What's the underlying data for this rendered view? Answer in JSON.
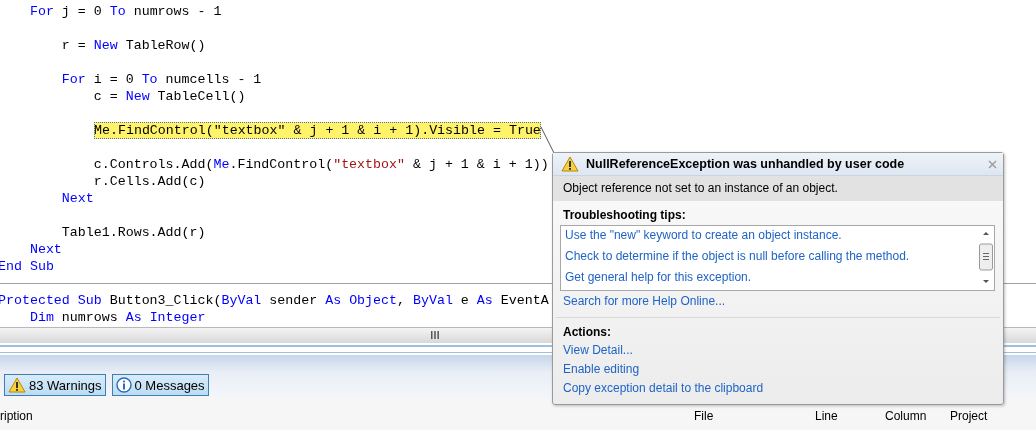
{
  "editor": {
    "lines": [
      {
        "kind": "code",
        "highlighted": false,
        "tokens": [
          {
            "text": "    For",
            "kind": "keyword"
          },
          {
            "text": " j = 0 ",
            "kind": "plain"
          },
          {
            "text": "To",
            "kind": "keyword"
          },
          {
            "text": " numrows - 1",
            "kind": "plain"
          }
        ]
      },
      {
        "kind": "blank"
      },
      {
        "kind": "code",
        "highlighted": false,
        "tokens": [
          {
            "text": "        r = ",
            "kind": "plain"
          },
          {
            "text": "New",
            "kind": "keyword"
          },
          {
            "text": " TableRow()",
            "kind": "plain"
          }
        ]
      },
      {
        "kind": "blank"
      },
      {
        "kind": "code",
        "highlighted": false,
        "tokens": [
          {
            "text": "        For",
            "kind": "keyword"
          },
          {
            "text": " i = 0 ",
            "kind": "plain"
          },
          {
            "text": "To",
            "kind": "keyword"
          },
          {
            "text": " numcells - 1",
            "kind": "plain"
          }
        ]
      },
      {
        "kind": "code",
        "highlighted": false,
        "tokens": [
          {
            "text": "            c = ",
            "kind": "plain"
          },
          {
            "text": "New",
            "kind": "keyword"
          },
          {
            "text": " TableCell()",
            "kind": "plain"
          }
        ]
      },
      {
        "kind": "blank"
      },
      {
        "kind": "code",
        "highlighted": true,
        "tokens": [
          {
            "text": "Me.FindControl(\"textbox\" & j + 1 & i + 1).Visible = True",
            "kind": "plain"
          }
        ]
      },
      {
        "kind": "blank"
      },
      {
        "kind": "code",
        "highlighted": false,
        "tokens": [
          {
            "text": "            c.Controls.Add(",
            "kind": "plain"
          },
          {
            "text": "Me",
            "kind": "keyword"
          },
          {
            "text": ".FindControl(",
            "kind": "plain"
          },
          {
            "text": "\"textbox\"",
            "kind": "string"
          },
          {
            "text": " & j + 1 & i + 1))",
            "kind": "plain"
          }
        ]
      },
      {
        "kind": "code",
        "highlighted": false,
        "tokens": [
          {
            "text": "            r.Cells.Add(c)",
            "kind": "plain"
          }
        ]
      },
      {
        "kind": "code",
        "highlighted": false,
        "tokens": [
          {
            "text": "        Next",
            "kind": "keyword"
          }
        ]
      },
      {
        "kind": "blank"
      },
      {
        "kind": "code",
        "highlighted": false,
        "tokens": [
          {
            "text": "        Table1.Rows.Add(r)",
            "kind": "plain"
          }
        ]
      },
      {
        "kind": "code",
        "highlighted": false,
        "tokens": [
          {
            "text": "    Next",
            "kind": "keyword"
          }
        ]
      },
      {
        "kind": "code",
        "highlighted": false,
        "tokens": [
          {
            "text": "End Sub",
            "kind": "keyword"
          }
        ]
      },
      {
        "kind": "divider"
      },
      {
        "kind": "code",
        "highlighted": false,
        "tokens": [
          {
            "text": "Protected Sub",
            "kind": "keyword"
          },
          {
            "text": " Button3_Click(",
            "kind": "plain"
          },
          {
            "text": "ByVal",
            "kind": "keyword"
          },
          {
            "text": " sender ",
            "kind": "plain"
          },
          {
            "text": "As Object",
            "kind": "keyword"
          },
          {
            "text": ", ",
            "kind": "plain"
          },
          {
            "text": "ByVal",
            "kind": "keyword"
          },
          {
            "text": " e ",
            "kind": "plain"
          },
          {
            "text": "As",
            "kind": "keyword"
          },
          {
            "text": " EventA",
            "kind": "plain"
          }
        ]
      },
      {
        "kind": "code",
        "highlighted": false,
        "tokens": [
          {
            "text": "    Dim",
            "kind": "keyword"
          },
          {
            "text": " numrows ",
            "kind": "plain"
          },
          {
            "text": "As Integer",
            "kind": "keyword"
          }
        ]
      }
    ]
  },
  "exception_popup": {
    "title": "NullReferenceException was unhandled by user code",
    "message": "Object reference not set to an instance of an object.",
    "tips_heading": "Troubleshooting tips:",
    "tips": [
      "Use the \"new\" keyword to create an object instance.",
      "Check to determine if the object is null before calling the method.",
      "Get general help for this exception."
    ],
    "search_link": "Search for more Help Online...",
    "actions_heading": "Actions:",
    "actions": [
      "View Detail...",
      "Enable editing",
      "Copy exception detail to the clipboard"
    ]
  },
  "error_list": {
    "filters": [
      {
        "kind": "warning",
        "label": "83 Warnings",
        "selected": true
      },
      {
        "kind": "info",
        "label": "0 Messages",
        "selected": true
      }
    ],
    "columns": [
      "ription",
      "File",
      "Line",
      "Column",
      "Project"
    ]
  }
}
